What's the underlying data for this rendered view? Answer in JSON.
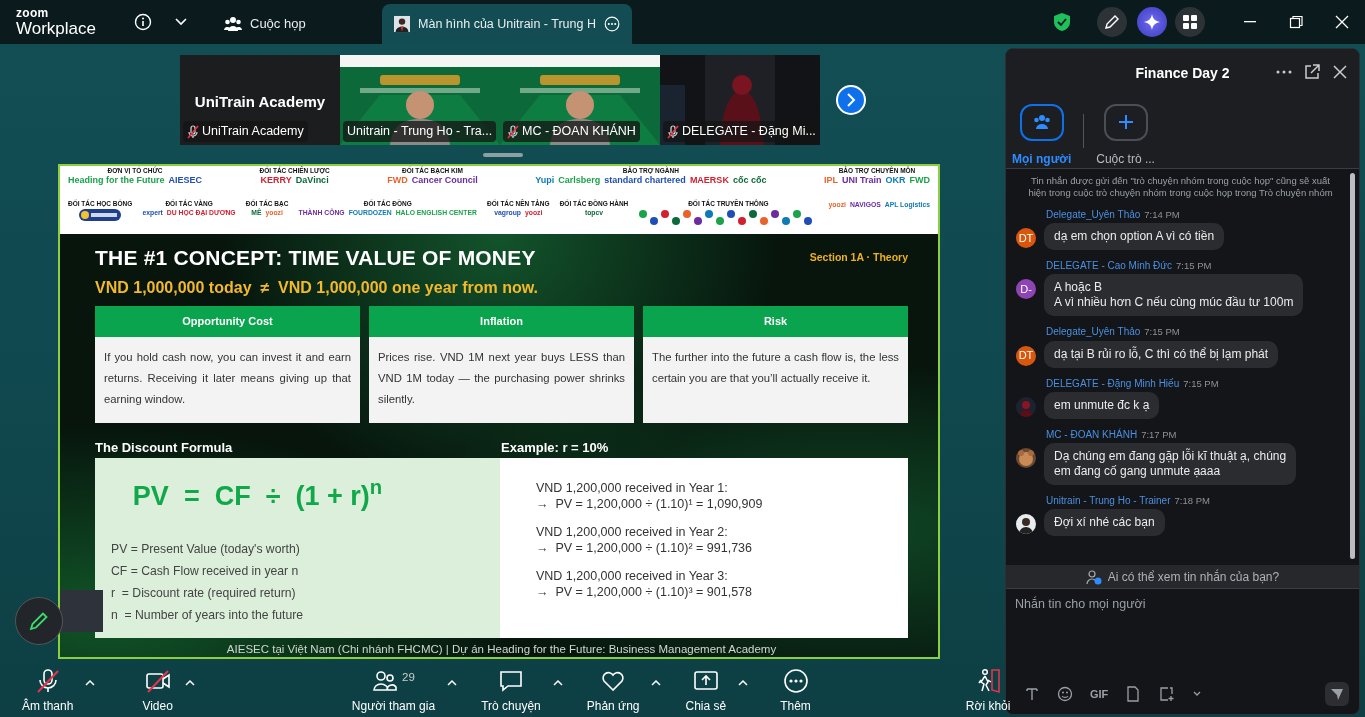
{
  "top_bar": {
    "brand": "zoom",
    "product": "Workplace",
    "tabs": [
      {
        "label": "Cuộc họp",
        "kind": "meeting",
        "selected": false
      },
      {
        "label": "Màn hình của Unitrain - Trung H",
        "kind": "share",
        "selected": true
      }
    ]
  },
  "video_strip": {
    "tiles": [
      {
        "kind": "name_card",
        "title": "UniTrain Academy",
        "name": "UniTrain Academy",
        "muted": true,
        "active": false
      },
      {
        "kind": "video",
        "name": "Unitrain - Trung Ho - Tra...",
        "muted": false,
        "active": true
      },
      {
        "kind": "video",
        "name": "MC - ĐOAN KHÁNH",
        "muted": true,
        "active": false
      },
      {
        "kind": "dark_video",
        "name": "DELEGATE - Đặng Mi...",
        "muted": true,
        "active": false
      }
    ]
  },
  "slide": {
    "sponsor_rows": [
      {
        "groups": [
          {
            "heading": "ĐƠN VỊ TỔ CHỨC",
            "logos": [
              "Heading for the Future",
              "AIESEC"
            ]
          },
          {
            "heading": "ĐỐI TÁC CHIẾN LƯỢC",
            "logos": [
              "KERRY",
              "DaVinci"
            ]
          },
          {
            "heading": "ĐỐI TÁC BẠCH KIM",
            "logos": [
              "FWD",
              "Cancer Council"
            ]
          },
          {
            "heading": "BẢO TRỢ NGÀNH",
            "logos": [
              "Yupi",
              "Carlsberg",
              "standard chartered",
              "MAERSK",
              "cốc cốc"
            ]
          },
          {
            "heading": "BẢO TRỢ CHUYÊN MÔN",
            "logos": [
              "IPL",
              "UNI Train",
              "OKR",
              "FWD"
            ]
          }
        ]
      },
      {
        "groups": [
          {
            "heading": "ĐỐI TÁC HỌC BỔNG",
            "kind": "badge"
          },
          {
            "heading": "ĐỐI TÁC VÀNG",
            "logos": [
              "expert",
              "DU HỌC ĐẠI DƯƠNG"
            ]
          },
          {
            "heading": "ĐỐI TÁC BẠC",
            "logos": [
              "MÊ",
              "yoozi"
            ]
          },
          {
            "heading": "ĐỐI TÁC ĐỒNG",
            "logos": [
              "THÀNH CÔNG",
              "FOURDOZEN",
              "HALO ENGLISH CENTER"
            ]
          },
          {
            "heading": "ĐỐI TÁC NỀN TẢNG",
            "logos": [
              "vagroup",
              "yoozi"
            ]
          },
          {
            "heading": "ĐỐI TÁC ĐỒNG HÀNH",
            "logos": [
              "topcv"
            ]
          },
          {
            "heading": "ĐỐI TÁC TRUYỀN THÔNG",
            "kind": "media"
          },
          {
            "logos": [
              "yoozi",
              "NAVIGOS",
              "APL Logistics"
            ]
          }
        ]
      }
    ],
    "title": "THE #1 CONCEPT: TIME VALUE OF MONEY",
    "section": "Section 1A · Theory",
    "subtitle": "VND 1,000,000 today  ≠  VND 1,000,000 one year from now.",
    "cards": [
      {
        "heading": "Opportunity Cost",
        "body": "If you hold cash now, you can invest it and earn returns. Receiving it later means giving up that earning window."
      },
      {
        "heading": "Inflation",
        "body": "Prices rise. VND 1M next year buys LESS than VND 1M today — the purchasing power shrinks silently."
      },
      {
        "heading": "Risk",
        "body": "The further into the future a cash flow is, the less certain you are that you’ll actually receive it."
      }
    ],
    "formula_label": "The Discount Formula",
    "example_label": "Example: r = 10%",
    "formula": "PV  =  CF  ÷  (1 + r)$^{n}$",
    "definitions": [
      "PV = Present Value (today's worth)",
      "CF = Cash Flow received in year n",
      "r  = Discount rate (required return)",
      "n  = Number of years into the future"
    ],
    "examples": [
      {
        "line_1": "VND 1,200,000 received in Year 1:",
        "line_2": "→  PV = 1,200,000 ÷ (1.10)¹ = 1,090,909"
      },
      {
        "line_1": "VND 1,200,000 received in Year 2:",
        "line_2": "→  PV = 1,200,000 ÷ (1.10)² = 991,736"
      },
      {
        "line_1": "VND 1,200,000 received in Year 3:",
        "line_2": "→  PV = 1,200,000 ÷ (1.10)³ = 901,578"
      }
    ],
    "footer": "AIESEC tại Việt Nam (Chi nhánh FHCMC) | Dự án Heading for the Future: Business Management Academy"
  },
  "chat": {
    "title": "Finance Day 2",
    "tabs": [
      {
        "label": "Mọi người",
        "kind": "people",
        "selected": true
      },
      {
        "label": "Cuộc trò ...",
        "kind": "add",
        "selected": false
      }
    ],
    "notice": "Tin nhắn được gửi đến \"trò chuyện nhóm trong cuộc họp\" cũng sẽ xuất hiện trong cuộc trò chuyện nhóm trong cuộc họp trong Trò chuyện nhóm",
    "messages": [
      {
        "sender": "Delegate_Uyên Thảo",
        "time": "7:14 PM",
        "avatar": {
          "kind": "initials",
          "text": "DT",
          "color": "#d9570d"
        },
        "lines": [
          "dạ em chọn option A vì có tiền"
        ]
      },
      {
        "sender": "DELEGATE - Cao Minh Đức",
        "time": "7:15 PM",
        "avatar": {
          "kind": "initials",
          "text": "D-",
          "color": "#8e44b5"
        },
        "lines": [
          "A hoặc B",
          "A vì nhiều hơn C nếu cùng múc đầu tư 100m"
        ]
      },
      {
        "sender": "Delegate_Uyên Thảo",
        "time": "7:15 PM",
        "avatar": {
          "kind": "initials",
          "text": "DT",
          "color": "#d9570d"
        },
        "lines": [
          "dạ tại B rủi ro lỗ, C thì có thể bị lạm phát"
        ]
      },
      {
        "sender": "DELEGATE - Đặng Minh Hiếu",
        "time": "7:15 PM",
        "avatar": {
          "kind": "dark_photo"
        },
        "lines": [
          "em unmute đc k ạ"
        ]
      },
      {
        "sender": "MC - ĐOAN KHÁNH",
        "time": "7:17 PM",
        "avatar": {
          "kind": "brown_photo"
        },
        "lines": [
          "Dạ chúng em đang gặp lỗi kĩ thuật ạ, chúng",
          "em đang cố gang unmute ạaaa"
        ]
      },
      {
        "sender": "Unitrain - Trung Ho - Trainer",
        "time": "7:18 PM",
        "avatar": {
          "kind": "person_photo"
        },
        "lines": [
          "Đợi xí nhé các bạn"
        ]
      }
    ],
    "privacy": "Ai có thể xem tin nhắn của bạn?",
    "input": {
      "placeholder": "Nhắn tin cho mọi người"
    },
    "gif": "GIF"
  },
  "toolbar": [
    {
      "kind": "mic",
      "label": "Âm thanh",
      "muted": true,
      "caret": true
    },
    {
      "kind": "video",
      "label": "Video",
      "muted": true,
      "caret": true
    },
    {
      "kind": "participants",
      "label": "Người tham gia",
      "count": "29",
      "caret": true
    },
    {
      "kind": "chat",
      "label": "Trò chuyện",
      "caret": true
    },
    {
      "kind": "reactions",
      "label": "Phản ứng",
      "caret": true
    },
    {
      "kind": "share",
      "label": "Chia sẻ",
      "caret": true
    },
    {
      "kind": "more",
      "label": "Thêm",
      "caret": false
    },
    {
      "kind": "leave",
      "label": "Rời khỏi",
      "caret": false
    }
  ]
}
